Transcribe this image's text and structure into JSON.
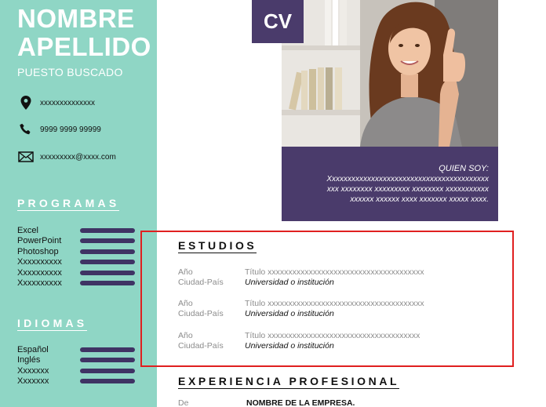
{
  "sidebar": {
    "name_line1": "NOMBRE",
    "name_line2": "APELLIDO",
    "job_title": "PUESTO BUSCADO",
    "contacts": [
      {
        "icon": "location-pin-icon",
        "text": "xxxxxxxxxxxxxx"
      },
      {
        "icon": "phone-icon",
        "text": "9999 9999 99999"
      },
      {
        "icon": "envelope-icon",
        "text": "xxxxxxxxx@xxxx.com"
      }
    ],
    "programs_title": "PROGRAMAS",
    "programs": [
      "Excel",
      "PowerPoint",
      "Photoshop",
      "Xxxxxxxxxx",
      "Xxxxxxxxxx",
      "Xxxxxxxxxx"
    ],
    "languages_title": "IDIOMAS",
    "languages": [
      "Español",
      "Inglés",
      "Xxxxxxx",
      "Xxxxxxx"
    ]
  },
  "header": {
    "cv_label": "CV",
    "about_heading": "QUIEN SOY:",
    "about_line1": "Xxxxxxxxxxxxxxxxxxxxxxxxxxxxxxxxxxxxxxxxx",
    "about_line2": "xxx xxxxxxxx xxxxxxxxx xxxxxxxx xxxxxxxxxxx",
    "about_line3": "xxxxxx xxxxxx xxxx xxxxxxx xxxxx xxxx."
  },
  "studies": {
    "title": "ESTUDIOS",
    "entries": [
      {
        "year": "Año",
        "title": "Título xxxxxxxxxxxxxxxxxxxxxxxxxxxxxxxxxxxxxx",
        "place": "Ciudad-País",
        "institution": "Universidad o institución"
      },
      {
        "year": "Año",
        "title": "Título xxxxxxxxxxxxxxxxxxxxxxxxxxxxxxxxxxxxxx",
        "place": "Ciudad-País",
        "institution": "Universidad o institución"
      },
      {
        "year": "Año",
        "title": "Título xxxxxxxxxxxxxxxxxxxxxxxxxxxxxxxxxxxxx",
        "place": "Ciudad-País",
        "institution": "Universidad o institución"
      }
    ]
  },
  "experience": {
    "title": "EXPERIENCIA PROFESIONAL",
    "from_label": "De",
    "company": "NOMBRE DE LA EMPRESA."
  },
  "colors": {
    "sidebar": "#8fd6c5",
    "accent_purple": "#4a3b6b",
    "bar": "#3f3364",
    "highlight": "#e02020"
  }
}
